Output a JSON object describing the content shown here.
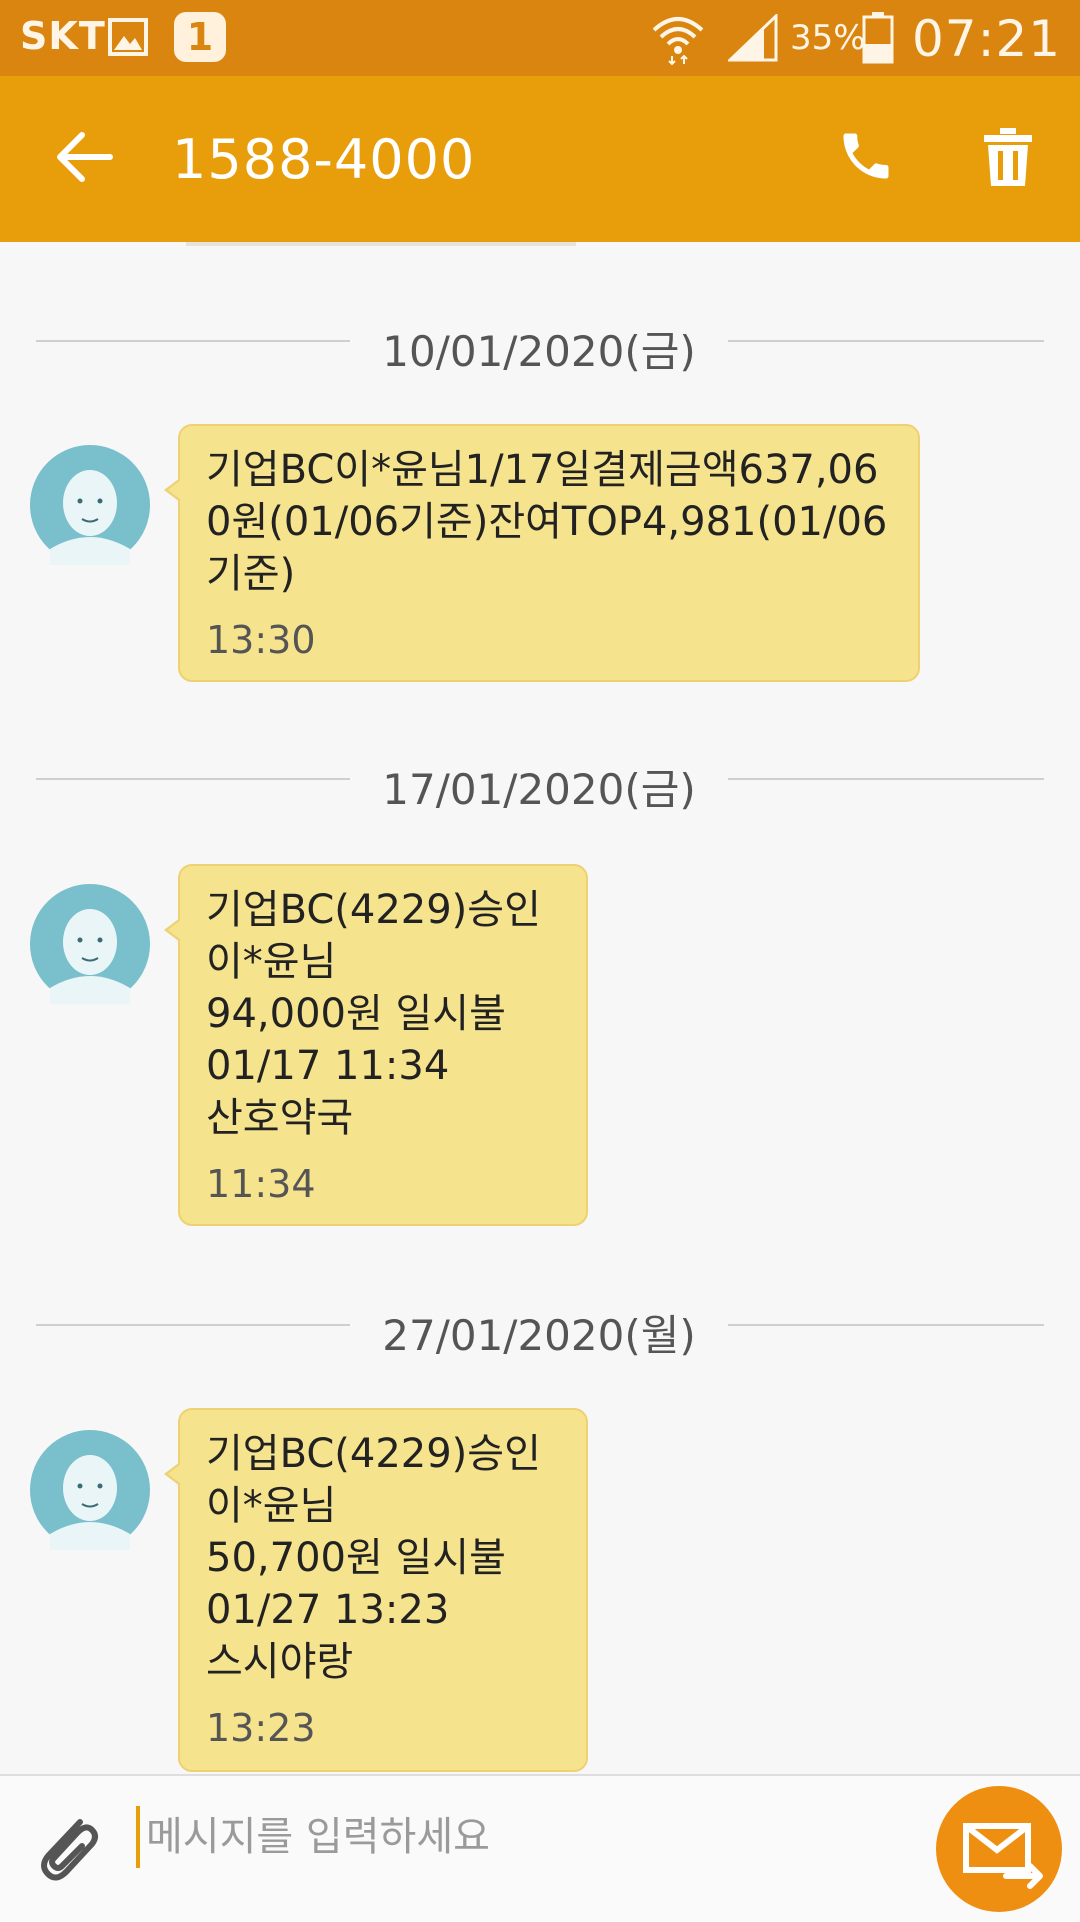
{
  "status_bar": {
    "carrier": "SKT",
    "notification_badge": "1",
    "battery_percent": "35%",
    "clock": "07:21"
  },
  "app_bar": {
    "title": "1588-4000"
  },
  "messages": [
    {
      "date": "10/01/2020(금)",
      "text": "기업BC이*윤님1/17일결제금액637,060원(01/06기준)잔여TOP4,981(01/06기준)",
      "time": "13:30"
    },
    {
      "date": "17/01/2020(금)",
      "text": "기업BC(4229)승인\n이*윤님\n94,000원 일시불\n01/17 11:34\n산호약국",
      "time": "11:34"
    },
    {
      "date": "27/01/2020(월)",
      "text": "기업BC(4229)승인\n이*윤님\n50,700원 일시불\n01/27 13:23\n스시야랑",
      "time": "13:23"
    }
  ],
  "composer": {
    "placeholder": "메시지를 입력하세요"
  },
  "colors": {
    "status_bar": "#d9850f",
    "app_bar": "#e89d0b",
    "bubble": "#f6e38e",
    "send_button": "#ef8f12",
    "avatar": "#79bfcc"
  },
  "icons": [
    "gallery-icon",
    "wifi-icon",
    "signal-icon",
    "battery-icon",
    "back-arrow-icon",
    "phone-icon",
    "trash-icon",
    "paperclip-icon",
    "send-message-icon",
    "contact-avatar-icon"
  ]
}
